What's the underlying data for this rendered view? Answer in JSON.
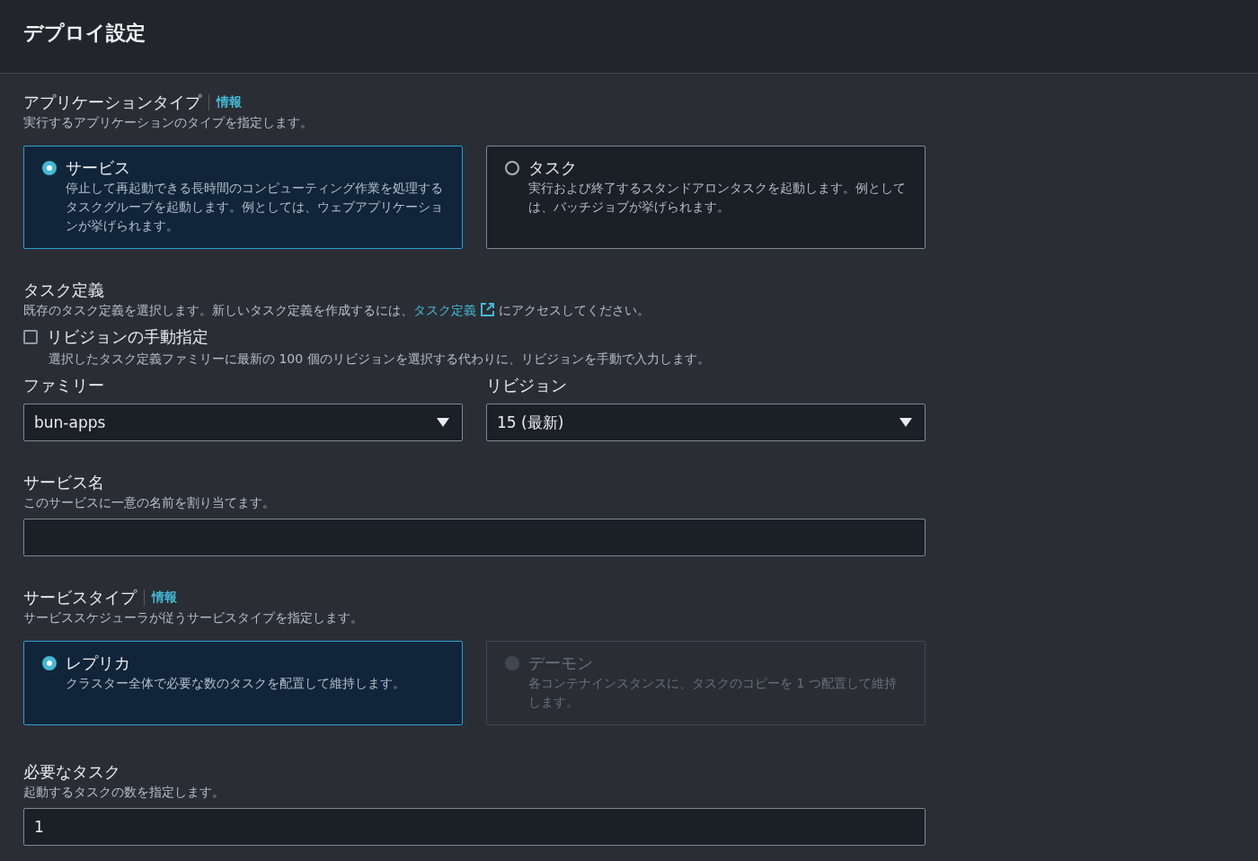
{
  "header": {
    "title": "デプロイ設定"
  },
  "sections": [
    {
      "kind": "radio_group",
      "label": "アプリケーションタイプ",
      "info": "情報",
      "description": "実行するアプリケーションのタイプを指定します。",
      "options": [
        {
          "title": "サービス",
          "description": "停止して再起動できる長時間のコンピューティング作業を処理するタスクグループを起動します。例としては、ウェブアプリケーションが挙げられます。",
          "selected": true,
          "disabled": false
        },
        {
          "title": "タスク",
          "description": "実行および終了するスタンドアロンタスクを起動します。例としては、バッチジョブが挙げられます。",
          "selected": false,
          "disabled": false
        }
      ]
    },
    {
      "kind": "task_definition",
      "label": "タスク定義",
      "description_before": "既存のタスク定義を選択します。新しいタスク定義を作成するには、",
      "link": "タスク定義",
      "description_after": "にアクセスしてください。",
      "manual_revision": {
        "label": "リビジョンの手動指定",
        "checked": false,
        "description": "選択したタスク定義ファミリーに最新の 100 個のリビジョンを選択する代わりに、リビジョンを手動で入力します。"
      },
      "selects": [
        {
          "label": "ファミリー",
          "value": "bun-apps"
        },
        {
          "label": "リビジョン",
          "value": "15 (最新)"
        }
      ]
    },
    {
      "kind": "text_input",
      "label": "サービス名",
      "description": "このサービスに一意の名前を割り当てます。"
    },
    {
      "kind": "radio_group",
      "label": "サービスタイプ",
      "info": "情報",
      "description": "サービススケジューラが従うサービスタイプを指定します。",
      "options": [
        {
          "title": "レプリカ",
          "description": "クラスター全体で必要な数のタスクを配置して維持します。",
          "selected": true,
          "disabled": false
        },
        {
          "title": "デーモン",
          "description": "各コンテナインスタンスに、タスクのコピーを 1 つ配置して維持します。",
          "selected": false,
          "disabled": true
        }
      ]
    },
    {
      "kind": "text_input",
      "label": "必要なタスク",
      "description": "起動するタスクの数を指定します。",
      "value": "1"
    }
  ]
}
